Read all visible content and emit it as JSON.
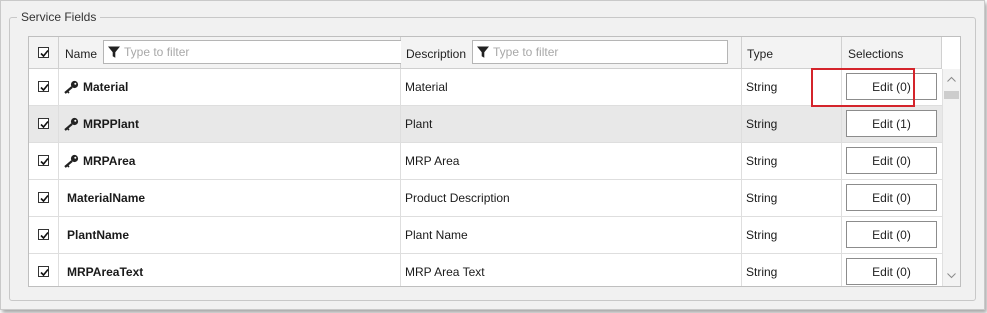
{
  "group": {
    "title": "Service Fields"
  },
  "columns": {
    "name": {
      "label": "Name",
      "filter_placeholder": "Type to filter"
    },
    "description": {
      "label": "Description",
      "filter_placeholder": "Type to filter"
    },
    "type": {
      "label": "Type"
    },
    "selections": {
      "label": "Selections"
    }
  },
  "header_checked": true,
  "rows": [
    {
      "checked": true,
      "key": true,
      "name": "Material",
      "description": "Material",
      "type": "String",
      "selections": "Edit (0)"
    },
    {
      "checked": true,
      "key": true,
      "name": "MRPPlant",
      "description": "Plant",
      "type": "String",
      "selections": "Edit (1)",
      "selected": true,
      "highlighted": true
    },
    {
      "checked": true,
      "key": true,
      "name": "MRPArea",
      "description": "MRP Area",
      "type": "String",
      "selections": "Edit (0)"
    },
    {
      "checked": true,
      "key": false,
      "name": "MaterialName",
      "description": "Product Description",
      "type": "String",
      "selections": "Edit (0)"
    },
    {
      "checked": true,
      "key": false,
      "name": "PlantName",
      "description": "Plant Name",
      "type": "String",
      "selections": "Edit (0)"
    },
    {
      "checked": true,
      "key": false,
      "name": "MRPAreaText",
      "description": "MRP Area Text",
      "type": "String",
      "selections": "Edit (0)"
    }
  ],
  "icons": {
    "key": "key-icon",
    "filter": "funnel-filter-icon",
    "scroll_up": "chevron-up-icon",
    "scroll_down": "chevron-down-icon"
  },
  "colors": {
    "highlight": "#d4242b",
    "selected_row": "#e8e8e8"
  }
}
